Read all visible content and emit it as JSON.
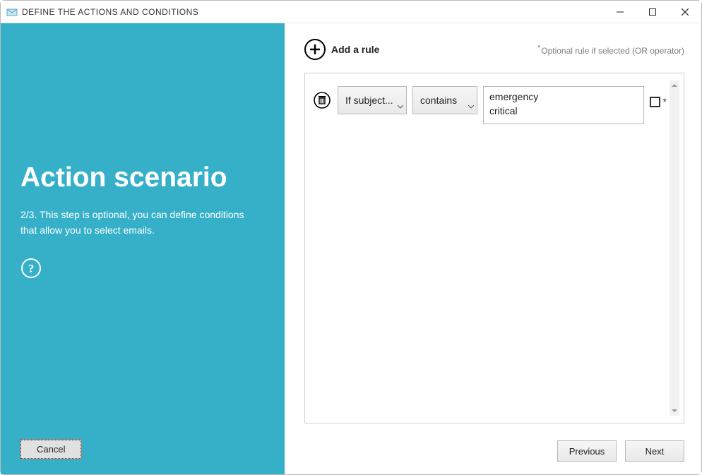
{
  "window": {
    "title": "DEFINE THE ACTIONS AND CONDITIONS"
  },
  "left": {
    "heading": "Action scenario",
    "description": "2/3. This step is optional, you can define conditions that allow you to select emails.",
    "cancel_label": "Cancel"
  },
  "top": {
    "add_rule_label": "Add a rule",
    "optional_hint": "Optional rule if selected (OR operator)"
  },
  "rules": [
    {
      "field_label": "If subject...",
      "operator_label": "contains",
      "value": "emergency\ncritical",
      "optional_star": "*"
    }
  ],
  "footer": {
    "previous_label": "Previous",
    "next_label": "Next"
  }
}
